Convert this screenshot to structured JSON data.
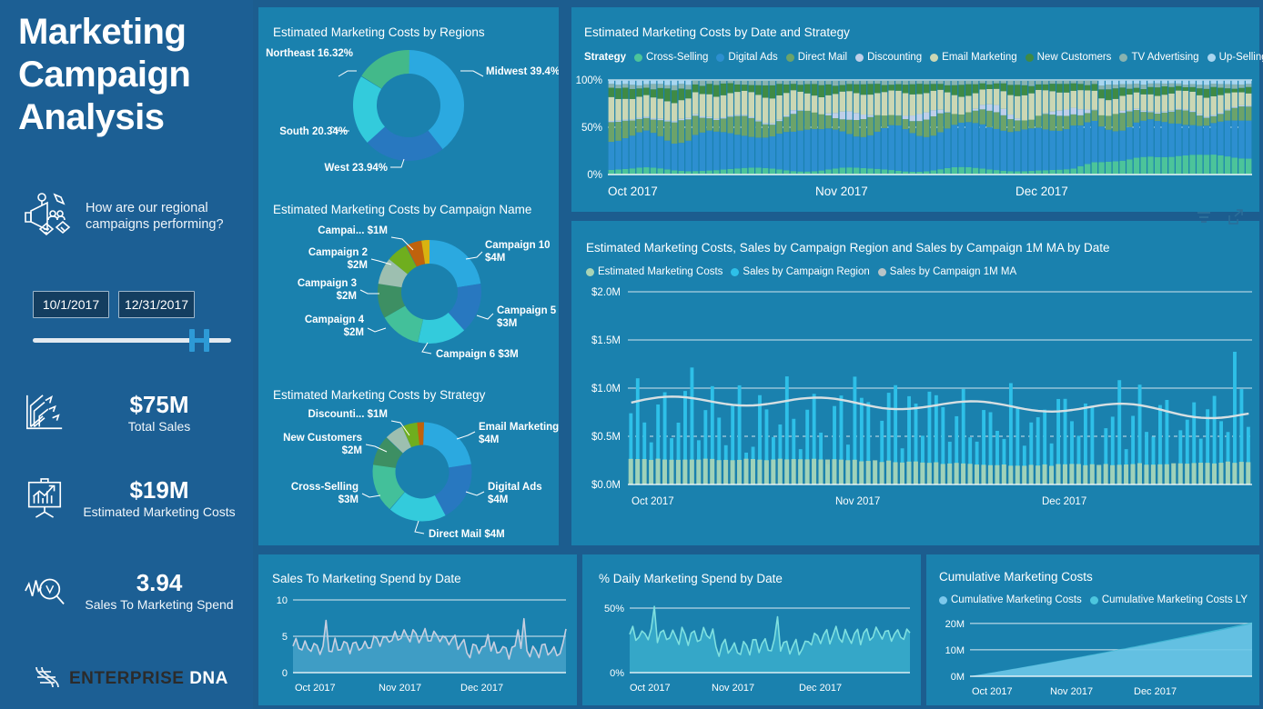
{
  "sidebar": {
    "title": "Marketing Campaign Analysis",
    "question": "How are our regional campaigns performing?",
    "slicer": {
      "start_date": "10/1/2017",
      "end_date": "12/31/2017"
    },
    "kpis": [
      {
        "value": "$75M",
        "label": "Total Sales",
        "icon": "growth-chart-icon"
      },
      {
        "value": "$19M",
        "label": "Estimated Marketing Costs",
        "icon": "presentation-chart-icon"
      },
      {
        "value": "3.94",
        "label": "Sales To Marketing Spend",
        "icon": "analytics-magnifier-icon"
      }
    ],
    "logo": {
      "bold": "ENTERPRISE",
      "light": "DNA"
    }
  },
  "colors": {
    "page_background": "#1c5d8f",
    "sidebar_background": "#1c5f94",
    "panel_background": "#1a81ae",
    "accent_blue": "#2d9ad6",
    "cyan": "#3fc8e4",
    "green": "#4cc4a0",
    "line_gray": "#d7dfe2"
  },
  "chart_data": [
    {
      "id": "regions",
      "type": "pie",
      "title": "Estimated Marketing Costs by Regions",
      "labels": [
        "Midwest",
        "West",
        "South",
        "Northeast"
      ],
      "values": [
        39.4,
        23.94,
        20.34,
        16.32
      ],
      "data_labels": [
        "Midwest 39.4%",
        "West 23.94%",
        "South 20.34%",
        "Northeast 16.32%"
      ],
      "colors": [
        "#2ba9e0",
        "#2878c0",
        "#33cbdc",
        "#43b98a"
      ]
    },
    {
      "id": "campaigns",
      "type": "pie",
      "title": "Estimated Marketing Costs by Campaign Name",
      "labels": [
        "Campaign 10",
        "Campaign 5",
        "Campaign 6",
        "Campaign 4",
        "Campaign 3",
        "Campaign 2",
        "Campai..."
      ],
      "values": [
        4,
        3,
        3,
        2,
        2,
        2,
        1
      ],
      "data_labels": [
        "Campaign 10 $4M",
        "Campaign 5 $3M",
        "Campaign 6 $3M",
        "Campaign 4 $2M",
        "Campaign 3 $2M",
        "Campaign 2 $2M",
        "Campai... $1M"
      ],
      "colors": [
        "#2ba9e0",
        "#2878c0",
        "#33cbdc",
        "#43c09a",
        "#3d8f63",
        "#9dbfb0",
        "#6fae1e",
        "#c0620c",
        "#d9b310"
      ]
    },
    {
      "id": "strategy",
      "type": "pie",
      "title": "Estimated Marketing Costs by Strategy",
      "labels": [
        "Email Marketing",
        "Digital Ads",
        "Direct Mail",
        "Cross-Selling",
        "New Customers",
        "Discounti..."
      ],
      "values": [
        4,
        4,
        4,
        3,
        2,
        1
      ],
      "data_labels": [
        "Email Marketing $4M",
        "Digital Ads $4M",
        "Direct Mail $4M",
        "Cross-Selling $3M",
        "New Customers $2M",
        "Discounti... $1M"
      ],
      "colors": [
        "#2ba9e0",
        "#2878c0",
        "#33cbdc",
        "#43c09a",
        "#3d8f63",
        "#9dbfb0",
        "#6fae1e",
        "#c0620c"
      ]
    },
    {
      "id": "stacked",
      "type": "bar",
      "title": "Estimated Marketing Costs by Date and Strategy",
      "legend_title": "Strategy",
      "stacked_100": true,
      "ylabel": "",
      "ytick_labels": [
        "0%",
        "50%",
        "100%"
      ],
      "ylim": [
        0,
        100
      ],
      "xtick_labels": [
        "Oct 2017",
        "Nov 2017",
        "Dec 2017"
      ],
      "series": [
        {
          "name": "Cross-Selling",
          "color": "#4cc49a"
        },
        {
          "name": "Digital Ads",
          "color": "#2d8fd0"
        },
        {
          "name": "Direct Mail",
          "color": "#6ca36a"
        },
        {
          "name": "Discounting",
          "color": "#bfcfe8"
        },
        {
          "name": "Email Marketing",
          "color": "#cbd7b4"
        },
        {
          "name": "New Customers",
          "color": "#3f8a45"
        },
        {
          "name": "TV Advertising",
          "color": "#89b3b0"
        },
        {
          "name": "Up-Selling",
          "color": "#a9d6f0"
        }
      ]
    },
    {
      "id": "combo",
      "type": "bar",
      "title": "Estimated Marketing Costs, Sales by Campaign Region and Sales by Campaign 1M MA by Date",
      "ytick_labels": [
        "$0.0M",
        "$0.5M",
        "$1.0M",
        "$1.5M",
        "$2.0M"
      ],
      "ylim": [
        0,
        2.0
      ],
      "xtick_labels": [
        "Oct 2017",
        "Nov 2017",
        "Dec 2017"
      ],
      "series": [
        {
          "name": "Estimated Marketing Costs",
          "color": "#a9d4b5",
          "type": "bar"
        },
        {
          "name": "Sales by Campaign Region",
          "color": "#2ec0e8",
          "type": "bar"
        },
        {
          "name": "Sales by Campaign 1M MA",
          "color": "#d7dfe2",
          "type": "line"
        }
      ]
    },
    {
      "id": "sales_to_spend",
      "type": "area",
      "title": "Sales To Marketing Spend by Date",
      "ytick_labels": [
        "0",
        "5",
        "10"
      ],
      "ylim": [
        0,
        10
      ],
      "xtick_labels": [
        "Oct 2017",
        "Nov 2017",
        "Dec 2017"
      ],
      "line_color": "#c8cfe0",
      "fill_color": "#5fb4d8"
    },
    {
      "id": "daily_spend",
      "type": "area",
      "title": "% Daily Marketing Spend by Date",
      "ytick_labels": [
        "0%",
        "50%"
      ],
      "ylim": [
        0,
        60
      ],
      "xtick_labels": [
        "Oct 2017",
        "Nov 2017",
        "Dec 2017"
      ],
      "line_color": "#7fe0e0",
      "fill_color": "#4cc6de"
    },
    {
      "id": "cumulative",
      "type": "area",
      "title": "Cumulative Marketing Costs",
      "ytick_labels": [
        "0M",
        "10M",
        "20M"
      ],
      "ylim": [
        0,
        22
      ],
      "xtick_labels": [
        "Oct 2017",
        "Nov 2017",
        "Dec 2017"
      ],
      "series": [
        {
          "name": "Cumulative Marketing Costs",
          "color": "#7cc8ec"
        },
        {
          "name": "Cumulative Marketing Costs LY",
          "color": "#4cc6de"
        }
      ],
      "end_values": [
        19.8,
        20.1
      ]
    }
  ],
  "toolbar": {
    "filter_icon": "filter-icon",
    "focus_icon": "focus-mode-icon"
  }
}
